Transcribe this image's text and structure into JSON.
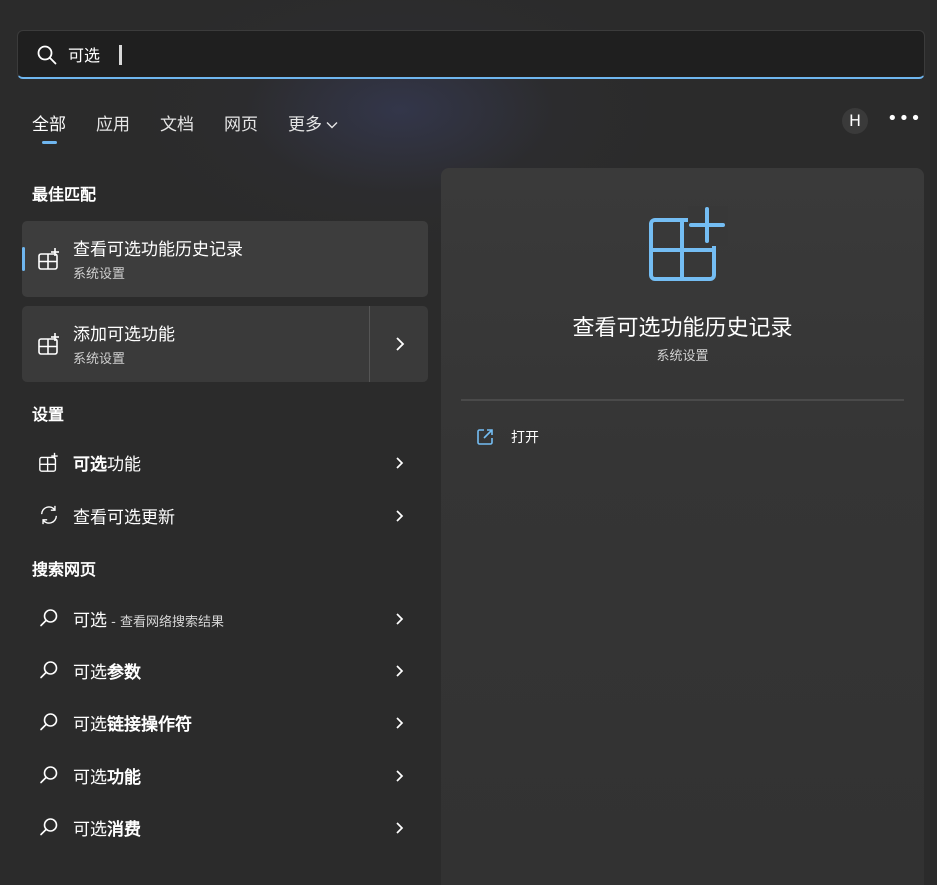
{
  "search": {
    "value": "可选",
    "placeholder": ""
  },
  "tabs": [
    {
      "label": "全部"
    },
    {
      "label": "应用"
    },
    {
      "label": "文档"
    },
    {
      "label": "网页"
    },
    {
      "label": "更多"
    }
  ],
  "header": {
    "avatar_letter": "H",
    "more_label": "•••"
  },
  "sections": {
    "best_match": "最佳匹配",
    "settings": "设置",
    "web": "搜索网页"
  },
  "best_match": [
    {
      "title": "查看可选功能历史记录",
      "subtitle": "系统设置"
    },
    {
      "title": "添加可选功能",
      "subtitle": "系统设置"
    }
  ],
  "settings_items": [
    {
      "bold": "可选",
      "rest": "功能"
    },
    {
      "plain": "查看可选更新"
    }
  ],
  "web_items": [
    {
      "plain": "可选",
      "small": " - 查看网络搜索结果"
    },
    {
      "plain": "可选",
      "bold": "参数"
    },
    {
      "plain": "可选",
      "bold": "链接操作符"
    },
    {
      "plain": "可选",
      "bold": "功能"
    },
    {
      "plain": "可选",
      "bold": "消费"
    }
  ],
  "preview": {
    "title": "查看可选功能历史记录",
    "subtitle": "系统设置",
    "action_label": "打开"
  },
  "colors": {
    "accent": "#6fb6ef",
    "background": "#2b2b2b",
    "card": "#3a3a3a"
  },
  "icons": {
    "search": "search-icon",
    "optional_features": "grid-plus-icon",
    "update": "refresh-icon",
    "web_search": "magnifier-icon",
    "chevron": "chevron-right-icon",
    "open": "open-external-icon"
  }
}
